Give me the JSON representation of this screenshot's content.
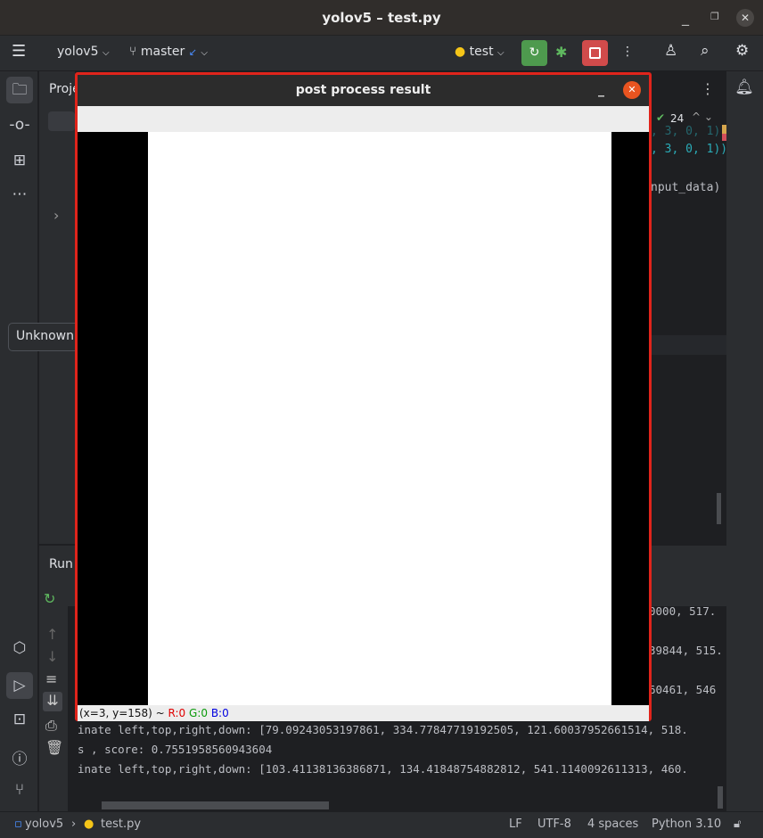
{
  "window": {
    "title": "yolov5 – test.py"
  },
  "toolbar": {
    "project": "yolov5",
    "branch": "master",
    "run_config": "test"
  },
  "project_panel": {
    "title": "Proje",
    "tooltip": "Unknown"
  },
  "editor": {
    "inspection_count": "24",
    "code_lines": [
      ", 3, 0, 1))",
      ", 3, 0, 1))",
      "nput_data)"
    ]
  },
  "run_panel": {
    "title": "Run",
    "console_lines": [
      "0000, 517.",
      "39844, 515.",
      "60461, 546",
      "inate left,top,right,down: [79.09243053197861, 334.77847719192505, 121.60037952661514, 518.",
      "s , score: 0.7551958560943604",
      "inate left,top,right,down: [103.41138136386871, 134.41848754882812, 541.1140092611313, 460."
    ]
  },
  "popup": {
    "title": "post process result",
    "coords": "(x=3, y=158) ~ ",
    "r": "R:0",
    "g": "G:0",
    "b": "B:0",
    "colors": {
      "r": "#e00000",
      "g": "#0a9a0a",
      "b": "#0000e0"
    }
  },
  "statusbar": {
    "project": "yolov5",
    "file": "test.py",
    "line_ending": "LF",
    "encoding": "UTF-8",
    "indent": "4 spaces",
    "interpreter": "Python 3.10"
  },
  "colors": {
    "run_green": "#4e9a4e",
    "stop_red": "#d14b4b",
    "popup_border": "#e0241b",
    "close_orange": "#e95420"
  }
}
